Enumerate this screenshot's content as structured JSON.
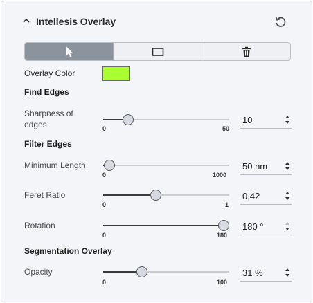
{
  "panel": {
    "title": "Intellesis Overlay",
    "icons": {
      "collapse": "chevron-up-icon",
      "reset": "reset-icon"
    }
  },
  "tools": [
    {
      "name": "pointer",
      "icon": "pointer-icon",
      "active": true
    },
    {
      "name": "rectangle",
      "icon": "rectangle-icon",
      "active": false
    },
    {
      "name": "delete",
      "icon": "trash-icon",
      "active": false
    }
  ],
  "overlay_color": {
    "label": "Overlay Color",
    "value": "#aaff33"
  },
  "sections": {
    "find_edges": "Find Edges",
    "filter_edges": "Filter Edges",
    "segmentation_overlay": "Segmentation Overlay"
  },
  "controls": {
    "sharpness": {
      "label_line1": "Sharpness of",
      "label_line2": "edges",
      "min": "0",
      "max": "50",
      "value": 10,
      "display": "10"
    },
    "min_length": {
      "label": "Minimum Length",
      "min": "0",
      "max": "1000",
      "value": 50,
      "display": "50 nm"
    },
    "feret_ratio": {
      "label": "Feret Ratio",
      "min": "0",
      "max": "1",
      "value": 0.42,
      "display": "0,42"
    },
    "rotation": {
      "label": "Rotation",
      "min": "0",
      "max": "180",
      "value": 180,
      "display": "180 °"
    },
    "opacity": {
      "label": "Opacity",
      "min": "0",
      "max": "100",
      "value": 31,
      "display": "31 %"
    }
  },
  "colors": {
    "active_tool": "#8b939c",
    "slider_fill": "#3a3a3a"
  }
}
